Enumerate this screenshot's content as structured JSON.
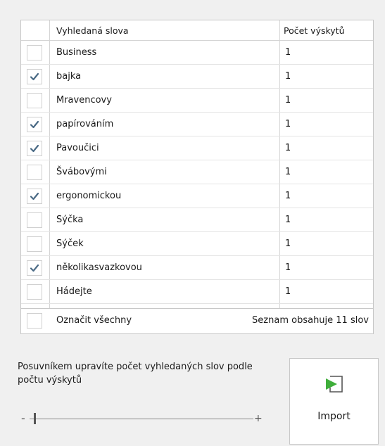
{
  "table": {
    "headers": {
      "word": "Vyhledaná slova",
      "count": "Počet výskytů"
    },
    "rows": [
      {
        "word": "Business",
        "count": "1",
        "checked": false
      },
      {
        "word": "bajka",
        "count": "1",
        "checked": true
      },
      {
        "word": "Mravencovy",
        "count": "1",
        "checked": false
      },
      {
        "word": "papírováním",
        "count": "1",
        "checked": true
      },
      {
        "word": "Pavoučici",
        "count": "1",
        "checked": true
      },
      {
        "word": "Švábovými",
        "count": "1",
        "checked": false
      },
      {
        "word": "ergonomickou",
        "count": "1",
        "checked": true
      },
      {
        "word": "Sýčka",
        "count": "1",
        "checked": false
      },
      {
        "word": "Sýček",
        "count": "1",
        "checked": false
      },
      {
        "word": "několikasvazkovou",
        "count": "1",
        "checked": true
      },
      {
        "word": "Hádejte",
        "count": "1",
        "checked": false
      }
    ],
    "footer": {
      "select_all_label": "Označit všechny",
      "select_all_checked": false,
      "summary": "Seznam obsahuje 11 slov"
    }
  },
  "slider": {
    "hint": "Posuvníkem upravíte počet vyhledaných slov podle počtu výskytů",
    "minus": "-",
    "plus": "+",
    "value_fraction": 0.02
  },
  "import_button": {
    "label": "Import",
    "icon": "import-icon"
  },
  "colors": {
    "check": "#4a6a85",
    "import_arrow": "#3fae3a",
    "import_frame": "#555555"
  }
}
